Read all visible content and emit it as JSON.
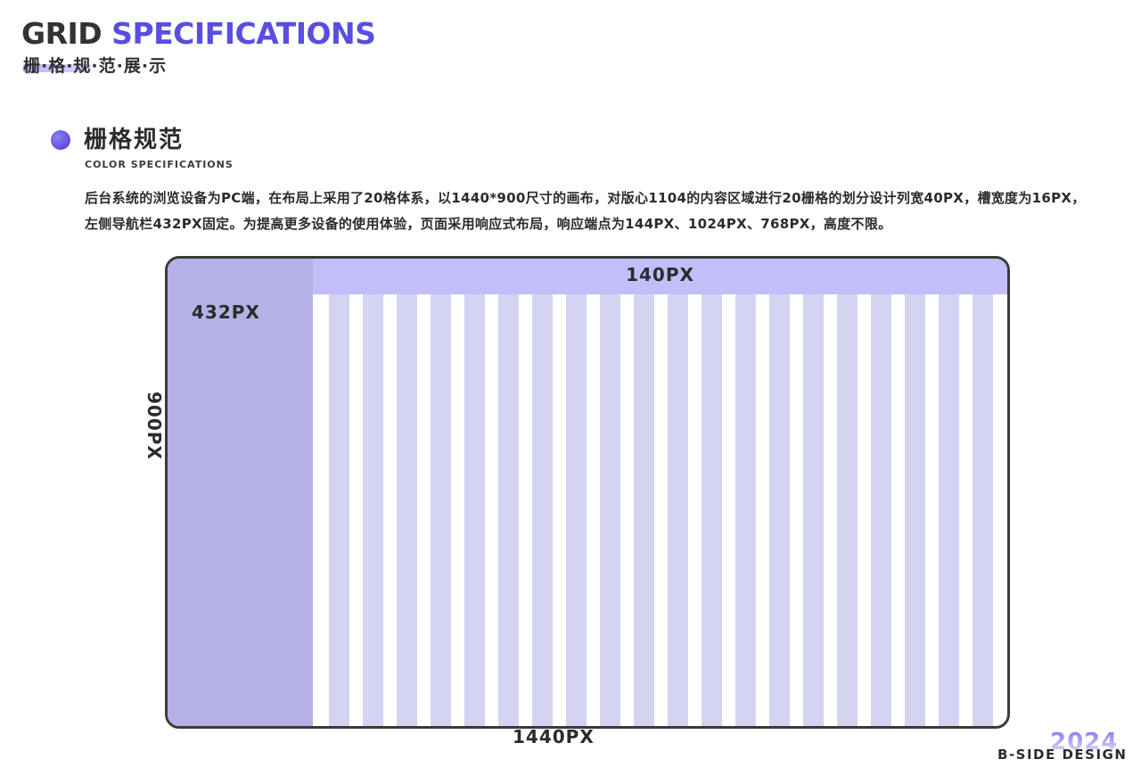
{
  "header": {
    "title_dark": "GRID",
    "title_accent": "SPECIFICATIONS",
    "subtitle": "栅·格·规·范·展·示"
  },
  "section": {
    "title": "栅格规范",
    "subtitle": "COLOR SPECIFICATIONS",
    "description": "后台系统的浏览设备为PC端，在布局上采用了20格体系，以1440*900尺寸的画布，对版心1104的内容区域进行20栅格的划分设计列宽40PX，槽宽度为16PX，左侧导航栏432PX固定。为提高更多设备的使用体验，页面采用响应式布局，响应端点为144PX、1024PX、768PX，高度不限。"
  },
  "diagram": {
    "sidebar_label": "432PX",
    "top_band_label": "140PX",
    "height_label": "900PX",
    "width_label": "1440PX",
    "column_count": 20,
    "colors": {
      "sidebar": "#b4b1e6",
      "top_band": "#c2bef9",
      "column": "#d4d3f2",
      "accent": "#5a4ee0"
    }
  },
  "brand": {
    "year": "2024",
    "name": "B-SIDE DESIGN"
  }
}
